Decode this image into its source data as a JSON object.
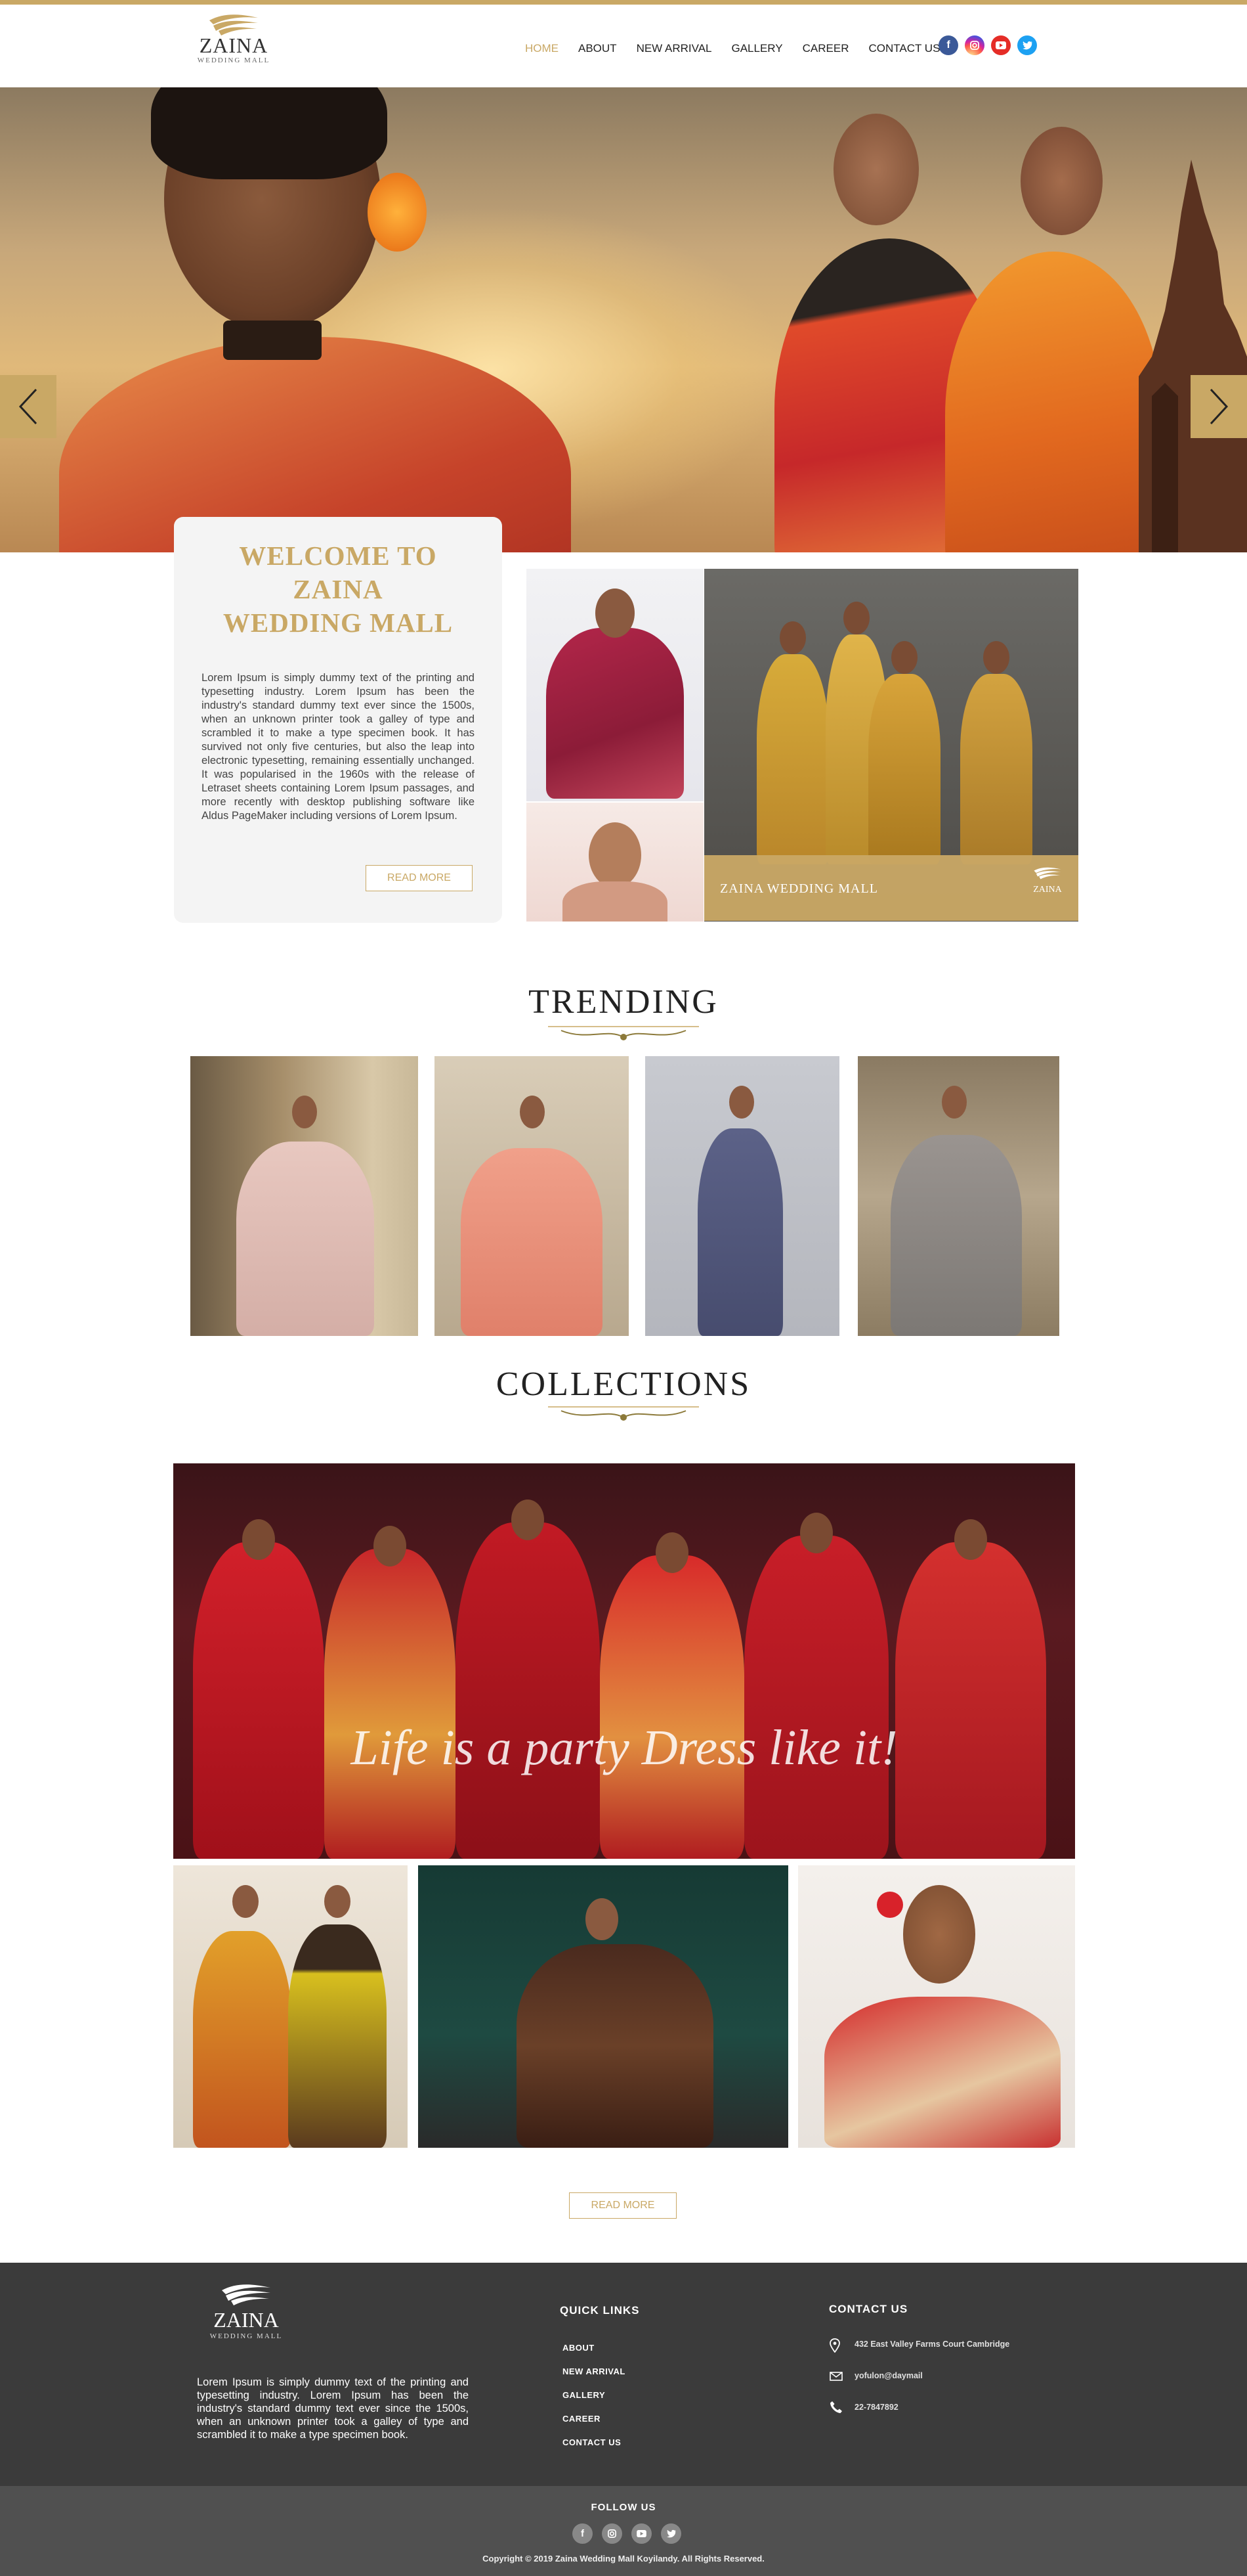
{
  "brand": {
    "name": "ZAINA",
    "sub": "WEDDING MALL",
    "accent": "#c9a865"
  },
  "nav": {
    "items": [
      "HOME",
      "ABOUT",
      "NEW ARRIVAL",
      "GALLERY",
      "CAREER",
      "CONTACT US"
    ],
    "active": "HOME"
  },
  "social": {
    "icons": [
      "facebook-icon",
      "instagram-icon",
      "youtube-icon",
      "twitter-icon"
    ],
    "colors": [
      "#3b5998",
      "#d6249f",
      "#e52d27",
      "#1da1f2"
    ]
  },
  "welcome": {
    "title_line1": "WELCOME TO",
    "title_line2": "ZAINA",
    "title_line3": "WEDDING MALL",
    "text": "Lorem Ipsum is simply dummy text of the printing and typesetting industry. Lorem Ipsum has been the industry's standard dummy text ever since the 1500s, when an unknown printer took a galley of type and scrambled it to make a type specimen book. It has survived not only five centuries, but also the leap into electronic typesetting, remaining essentially unchanged. It was popularised in the 1960s with the release of Letraset sheets containing Lorem Ipsum passages, and more recently with desktop publishing software like Aldus PageMaker including versions of Lorem Ipsum.",
    "read_more": "READ MORE"
  },
  "banner": {
    "text": "ZAINA WEDDING MALL"
  },
  "trending": {
    "title": "TRENDING"
  },
  "collections": {
    "title": "COLLECTIONS",
    "tagline": "Life is a party Dress like it!",
    "read_more": "READ MORE"
  },
  "footer": {
    "description": "Lorem Ipsum is simply dummy text of the printing and typesetting industry. Lorem Ipsum has been the industry's standard dummy text ever since the 1500s, when an unknown printer took a galley of type and scrambled it to make a type specimen book.",
    "quick_links_title": "QUICK LINKS",
    "quick_links": [
      "ABOUT",
      "NEW ARRIVAL",
      "GALLERY",
      "CAREER",
      "CONTACT US"
    ],
    "contact_title": "CONTACT US",
    "address": "432 East Valley Farms Court Cambridge",
    "email": "yofulon@daymail",
    "phone": "22-7847892",
    "follow_us": "FOLLOW US",
    "copyright": "Copyright © 2019 Zaina Wedding Mall Koyilandy. All Rights Reserved."
  }
}
